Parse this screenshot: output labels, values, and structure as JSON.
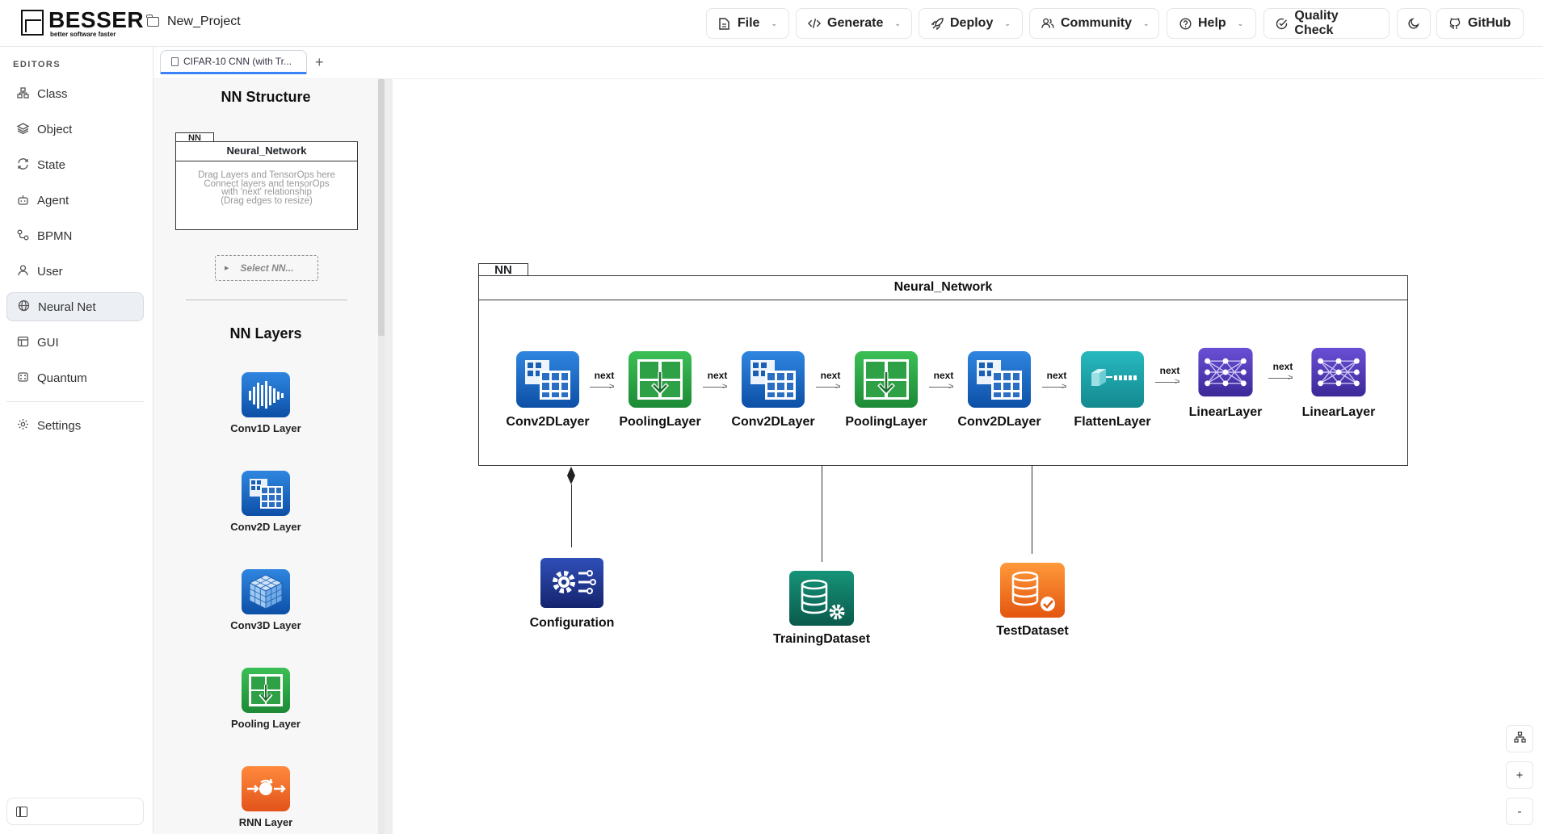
{
  "app": {
    "logo_text": "BESSER",
    "logo_tagline": "better software faster",
    "project_name": "New_Project"
  },
  "menus": [
    {
      "label": "File",
      "icon": "file-icon"
    },
    {
      "label": "Generate",
      "icon": "code-icon"
    },
    {
      "label": "Deploy",
      "icon": "rocket-icon"
    },
    {
      "label": "Community",
      "icon": "users-icon"
    },
    {
      "label": "Help",
      "icon": "help-circle-icon"
    },
    {
      "label": "Quality Check",
      "icon": "check-circle-icon"
    },
    {
      "label": "",
      "icon": "moon-icon"
    },
    {
      "label": "GitHub",
      "icon": "github-icon"
    }
  ],
  "sidebar": {
    "section_label": "EDITORS",
    "items": [
      {
        "label": "Class",
        "icon": "class-diagram-icon"
      },
      {
        "label": "Object",
        "icon": "layers-icon"
      },
      {
        "label": "State",
        "icon": "refresh-icon"
      },
      {
        "label": "Agent",
        "icon": "bot-icon"
      },
      {
        "label": "BPMN",
        "icon": "workflow-icon"
      },
      {
        "label": "User",
        "icon": "user-icon"
      },
      {
        "label": "Neural Net",
        "icon": "globe-icon",
        "active": true
      },
      {
        "label": "GUI",
        "icon": "layout-icon"
      },
      {
        "label": "Quantum",
        "icon": "atom-icon"
      },
      {
        "label": "Settings",
        "icon": "gear-icon"
      }
    ]
  },
  "tabs": [
    {
      "label": "CIFAR-10 CNN (with Tr..."
    }
  ],
  "palette": {
    "structure_title": "NN Structure",
    "mini_nn": {
      "tab_label": "NN",
      "title": "Neural_Network",
      "hint_lines": [
        "Drag Layers and TensorOps here",
        "Connect layers and tensorOps",
        "with 'next' relationship",
        "(Drag edges to resize)"
      ]
    },
    "select_nn_label": "Select NN...",
    "layers_title": "NN Layers",
    "layers": [
      {
        "label": "Conv1D Layer",
        "icon": "conv1d-icon"
      },
      {
        "label": "Conv2D Layer",
        "icon": "conv2d-icon"
      },
      {
        "label": "Conv3D Layer",
        "icon": "conv3d-icon"
      },
      {
        "label": "Pooling Layer",
        "icon": "pooling-icon"
      },
      {
        "label": "RNN Layer",
        "icon": "rnn-icon"
      }
    ]
  },
  "diagram": {
    "nn_tab_label": "NN",
    "nn_title": "Neural_Network",
    "layers": [
      {
        "label": "Conv2DLayer",
        "icon": "conv2d-icon"
      },
      {
        "label": "PoolingLayer",
        "icon": "pooling-icon"
      },
      {
        "label": "Conv2DLayer",
        "icon": "conv2d-icon"
      },
      {
        "label": "PoolingLayer",
        "icon": "pooling-icon"
      },
      {
        "label": "Conv2DLayer",
        "icon": "conv2d-icon"
      },
      {
        "label": "FlattenLayer",
        "icon": "flatten-icon"
      },
      {
        "label": "LinearLayer",
        "icon": "linear-icon"
      },
      {
        "label": "LinearLayer",
        "icon": "linear-icon"
      }
    ],
    "edge_label": "next",
    "external": [
      {
        "label": "Configuration",
        "icon": "configuration-icon"
      },
      {
        "label": "TrainingDataset",
        "icon": "training-dataset-icon"
      },
      {
        "label": "TestDataset",
        "icon": "test-dataset-icon"
      }
    ]
  },
  "zoom_controls": [
    {
      "label": "",
      "icon": "layout-tree-icon"
    },
    {
      "label": "+",
      "icon": "zoom-in-icon"
    },
    {
      "label": "-",
      "icon": "zoom-out-icon"
    }
  ],
  "colors": {
    "accent": "#3b82f6",
    "conv_blue": "#1565c0",
    "pool_green": "#2e9d43",
    "flatten_teal": "#17a0a8",
    "linear_purple": "#4b34b0",
    "config_navy": "#1e3a8a",
    "train_teal": "#0f6e5e",
    "test_orange": "#f07a1b"
  }
}
